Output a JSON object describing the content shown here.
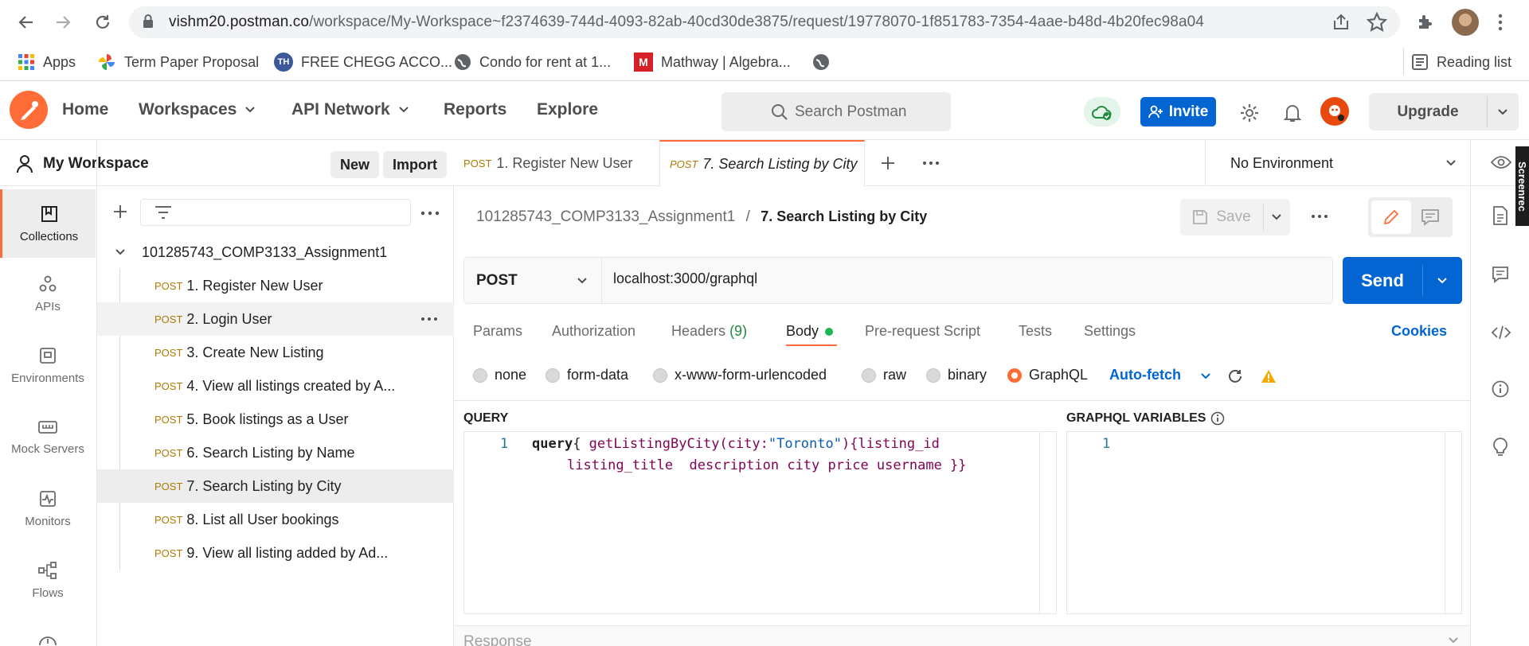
{
  "browser": {
    "url_host": "vishm20.postman.co",
    "url_path": "/workspace/My-Workspace~f2374639-744d-4093-82ab-40cd30de3875/request/19778070-1f851783-7354-4aae-b48d-4b20fec98a04",
    "bookmarks": {
      "apps": "Apps",
      "b1": "Term Paper Proposal",
      "b2": "FREE CHEGG ACCO...",
      "b3": "Condo for rent at 1...",
      "b4": "Mathway | Algebra..."
    },
    "reading_list": "Reading list"
  },
  "header": {
    "home": "Home",
    "workspaces": "Workspaces",
    "api_network": "API Network",
    "reports": "Reports",
    "explore": "Explore",
    "search_placeholder": "Search Postman",
    "invite": "Invite",
    "upgrade": "Upgrade"
  },
  "rail": {
    "collections": "Collections",
    "apis": "APIs",
    "environments": "Environments",
    "mock_servers": "Mock Servers",
    "monitors": "Monitors",
    "flows": "Flows"
  },
  "workspace": {
    "title": "My Workspace",
    "new": "New",
    "import": "Import",
    "collection_name": "101285743_COMP3133_Assignment1",
    "requests": [
      {
        "method": "POST",
        "name": "1. Register New User"
      },
      {
        "method": "POST",
        "name": "2. Login User"
      },
      {
        "method": "POST",
        "name": "3. Create New Listing"
      },
      {
        "method": "POST",
        "name": "4. View all listings created by A..."
      },
      {
        "method": "POST",
        "name": "5. Book listings as a User"
      },
      {
        "method": "POST",
        "name": "6. Search Listing by Name"
      },
      {
        "method": "POST",
        "name": "7. Search Listing by City"
      },
      {
        "method": "POST",
        "name": "8. List all User bookings"
      },
      {
        "method": "POST",
        "name": "9. View all listing added by Ad..."
      }
    ]
  },
  "tabs": [
    {
      "method": "POST",
      "name": "1. Register New User"
    },
    {
      "method": "POST",
      "name": "7. Search Listing by City"
    }
  ],
  "environment": "No Environment",
  "request": {
    "breadcrumb_collection": "101285743_COMP3133_Assignment1",
    "breadcrumb_sep": "/",
    "breadcrumb_request": "7. Search Listing by City",
    "save": "Save",
    "method": "POST",
    "url": "localhost:3000/graphql",
    "send": "Send",
    "subtabs": {
      "params": "Params",
      "authorization": "Authorization",
      "headers": "Headers",
      "headers_count": "(9)",
      "body": "Body",
      "prerequest": "Pre-request Script",
      "tests": "Tests",
      "settings": "Settings"
    },
    "cookies": "Cookies",
    "body_types": {
      "none": "none",
      "form_data": "form-data",
      "urlencoded": "x-www-form-urlencoded",
      "raw": "raw",
      "binary": "binary",
      "graphql": "GraphQL"
    },
    "auto_fetch": "Auto-fetch",
    "query_label": "QUERY",
    "variables_label": "GRAPHQL VARIABLES",
    "query_line_no": "1",
    "vars_line_no": "1",
    "query": {
      "kw": "query",
      "open": "{ ",
      "fn": "getListingByCity",
      "arg_open": "(city:",
      "arg_val": "\"Toronto\"",
      "arg_close": ")",
      "fields_line1": "{listing_id",
      "fields_line2": "listing_title  description city price username }}"
    }
  },
  "response_label": "Response",
  "screen_rec": "Screenrec"
}
